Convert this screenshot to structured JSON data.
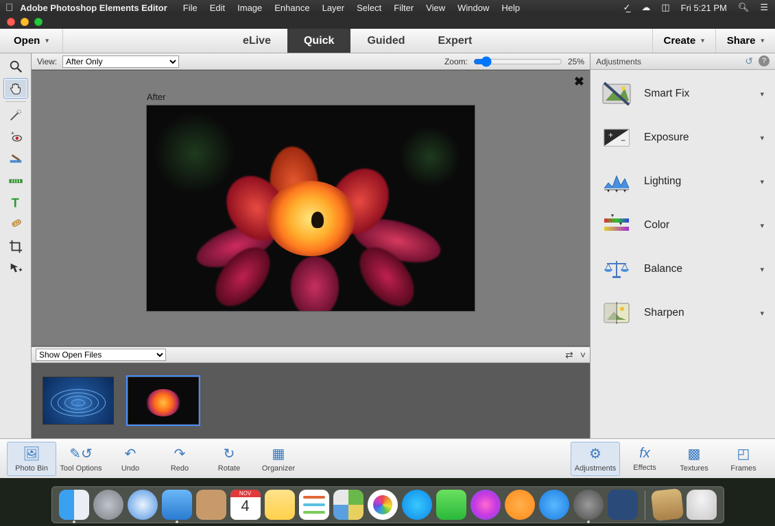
{
  "menubar": {
    "appname": "Adobe Photoshop Elements Editor",
    "items": [
      "File",
      "Edit",
      "Image",
      "Enhance",
      "Layer",
      "Select",
      "Filter",
      "View",
      "Window",
      "Help"
    ],
    "clock": "Fri 5:21 PM"
  },
  "topbar": {
    "open": "Open",
    "modes": [
      "eLive",
      "Quick",
      "Guided",
      "Expert"
    ],
    "active_mode": "Quick",
    "create": "Create",
    "share": "Share"
  },
  "viewstrip": {
    "view_label": "View:",
    "view_value": "After Only",
    "zoom_label": "Zoom:",
    "zoom_value": "25%"
  },
  "canvas": {
    "label": "After"
  },
  "openfiles": {
    "dropdown": "Show Open Files"
  },
  "rightpanel": {
    "title": "Adjustments",
    "items": [
      "Smart Fix",
      "Exposure",
      "Lighting",
      "Color",
      "Balance",
      "Sharpen"
    ]
  },
  "bottombar": {
    "left": [
      "Photo Bin",
      "Tool Options",
      "Undo",
      "Redo",
      "Rotate",
      "Organizer"
    ],
    "right": [
      "Adjustments",
      "Effects",
      "Textures",
      "Frames"
    ]
  },
  "tools": [
    "zoom",
    "hand",
    "lasso",
    "redeye",
    "whiten",
    "quick-select",
    "type",
    "healing",
    "crop",
    "move"
  ],
  "dock": {
    "items": [
      "finder",
      "launchpad",
      "safari",
      "mail",
      "contacts",
      "calendar",
      "notes",
      "reminders",
      "maps",
      "photos",
      "messages",
      "facetime",
      "itunes",
      "ibooks",
      "appstore",
      "preferences",
      "psedash"
    ],
    "calendar_day": "4",
    "calendar_month": "NOV",
    "running": [
      "finder",
      "mail",
      "preferences"
    ]
  }
}
